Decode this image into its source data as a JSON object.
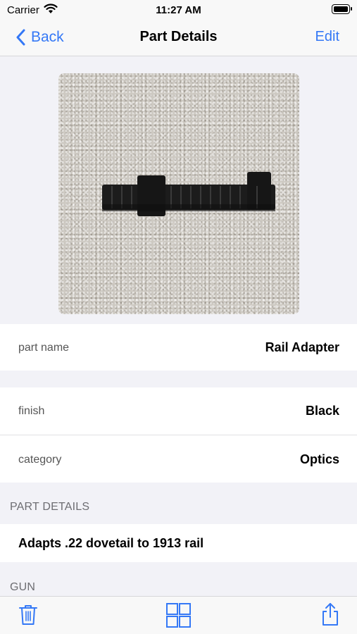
{
  "status_bar": {
    "carrier": "Carrier",
    "time": "11:27 AM",
    "icons": [
      "wifi-icon",
      "battery-icon"
    ]
  },
  "nav": {
    "back_label": "Back",
    "title": "Part Details",
    "edit_label": "Edit"
  },
  "photo": {
    "description_icon": "part-photo"
  },
  "fields": [
    {
      "label": "part name",
      "value": "Rail Adapter"
    },
    {
      "label": "finish",
      "value": "Black"
    },
    {
      "label": "category",
      "value": "Optics"
    }
  ],
  "sections": {
    "part_details_header": "PART DETAILS",
    "part_details_text": "Adapts .22 dovetail to 1913 rail",
    "gun_header": "GUN"
  },
  "toolbar": {
    "icons": [
      "trash-icon",
      "grid-icon",
      "share-icon"
    ]
  },
  "colors": {
    "accent": "#3478f6",
    "background": "#f2f2f7"
  }
}
